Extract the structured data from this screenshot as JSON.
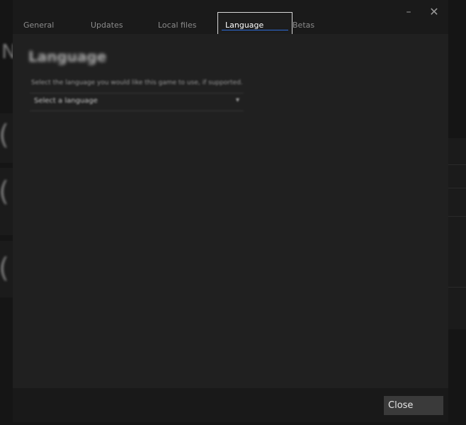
{
  "dialog": {
    "tabs": [
      {
        "label": "General"
      },
      {
        "label": "Updates"
      },
      {
        "label": "Local files"
      },
      {
        "label": "Language"
      },
      {
        "label": "Betas"
      }
    ],
    "active_tab": "Language",
    "window_controls": {
      "minimize_icon": "minimize-icon",
      "close_icon": "close-icon"
    },
    "content": {
      "section_title": "Language",
      "description": "Select the language you would like this game to use, if supported.",
      "language_select_value": "Select a language"
    },
    "footer": {
      "close_label": "Close"
    }
  },
  "colors": {
    "accent": "#2d6bd8",
    "background": "#1e1e1e"
  }
}
